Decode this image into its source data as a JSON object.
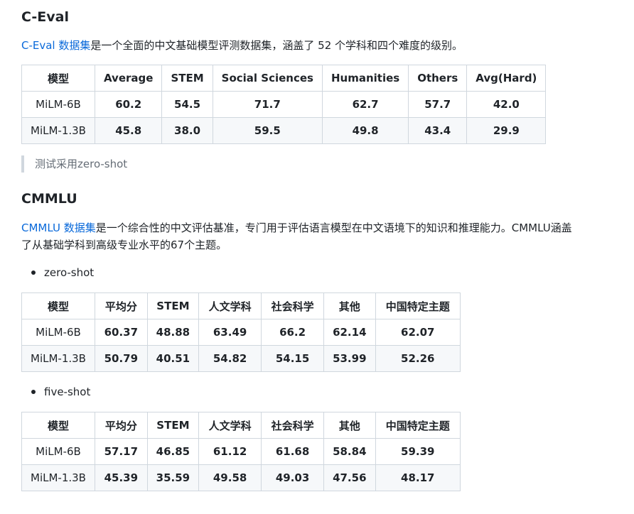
{
  "ceval": {
    "heading": "C-Eval",
    "intro_link": "C-Eval 数据集",
    "intro_rest": "是一个全面的中文基础模型评测数据集，涵盖了 52 个学科和四个难度的级别。",
    "headers": [
      "模型",
      "Average",
      "STEM",
      "Social Sciences",
      "Humanities",
      "Others",
      "Avg(Hard)"
    ],
    "rows": [
      [
        "MiLM-6B",
        "60.2",
        "54.5",
        "71.7",
        "62.7",
        "57.7",
        "42.0"
      ],
      [
        "MiLM-1.3B",
        "45.8",
        "38.0",
        "59.5",
        "49.8",
        "43.4",
        "29.9"
      ]
    ],
    "note": "测试采用zero-shot"
  },
  "cmmlu": {
    "heading": "CMMLU",
    "intro_link": "CMMLU 数据集",
    "intro_rest_line1": "是一个综合性的中文评估基准，专门用于评估语言模型在中文语境下的知识和推理能力。CMMLU涵盖",
    "intro_rest_line2": "了从基础学科到高级专业水平的67个主题。",
    "zero_shot": {
      "label": "zero-shot",
      "headers": [
        "模型",
        "平均分",
        "STEM",
        "人文学科",
        "社会科学",
        "其他",
        "中国特定主题"
      ],
      "rows": [
        [
          "MiLM-6B",
          "60.37",
          "48.88",
          "63.49",
          "66.2",
          "62.14",
          "62.07"
        ],
        [
          "MiLM-1.3B",
          "50.79",
          "40.51",
          "54.82",
          "54.15",
          "53.99",
          "52.26"
        ]
      ]
    },
    "five_shot": {
      "label": "five-shot",
      "headers": [
        "模型",
        "平均分",
        "STEM",
        "人文学科",
        "社会科学",
        "其他",
        "中国特定主题"
      ],
      "rows": [
        [
          "MiLM-6B",
          "57.17",
          "46.85",
          "61.12",
          "61.68",
          "58.84",
          "59.39"
        ],
        [
          "MiLM-1.3B",
          "45.39",
          "35.59",
          "49.58",
          "49.03",
          "47.56",
          "48.17"
        ]
      ]
    }
  }
}
